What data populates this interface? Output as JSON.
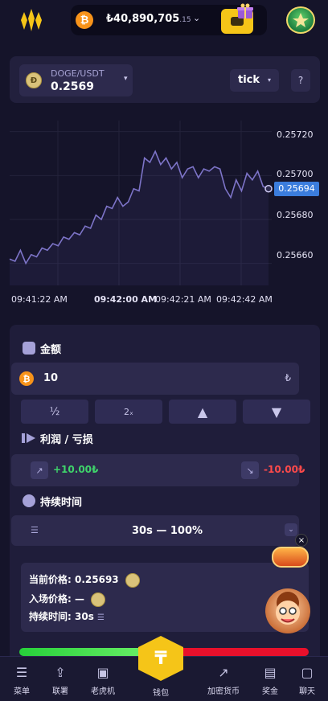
{
  "header": {
    "balance_currency_icon": "bitcoin-icon",
    "balance_main": "₺40,890,705",
    "balance_decimal": ".15",
    "balance_caret": "⌄"
  },
  "pair": {
    "name": "DOGE/USDT",
    "price": "0.2569",
    "caret": "▾"
  },
  "chart_toolbar": {
    "mode": "tick",
    "mode_caret": "▾",
    "help": "?"
  },
  "chart_data": {
    "type": "line",
    "x_ticks": [
      "09:41:22 AM",
      "09:42:00 AM",
      "09:42:21 AM",
      "09:42:42 AM"
    ],
    "y_ticks": [
      "0.25720",
      "0.25700",
      "0.25680",
      "0.25660"
    ],
    "ylim": [
      0.2565,
      0.25725
    ],
    "current_price_label": "0.25694",
    "current_value": 0.25694,
    "series": [
      {
        "values": [
          0.25662,
          0.25661,
          0.25666,
          0.2566,
          0.25664,
          0.25663,
          0.25667,
          0.25666,
          0.25669,
          0.25668,
          0.25672,
          0.25671,
          0.25674,
          0.25673,
          0.25677,
          0.25676,
          0.25682,
          0.2568,
          0.25686,
          0.25685,
          0.2569,
          0.25686,
          0.25688,
          0.25694,
          0.25693,
          0.25708,
          0.25706,
          0.25711,
          0.25705,
          0.25708,
          0.25703,
          0.25706,
          0.25699,
          0.25703,
          0.25704,
          0.25699,
          0.25703,
          0.25702,
          0.25704,
          0.25703,
          0.25694,
          0.2569,
          0.25698,
          0.25693,
          0.25701,
          0.25698,
          0.25702,
          0.25695,
          0.25694
        ]
      }
    ],
    "grid": true
  },
  "trade": {
    "amount_label": "金额",
    "amount_value": "10",
    "amount_unit": "₺",
    "half_label": "½",
    "double_label": "2ₓ",
    "up_label": "▲",
    "down_label": "▼",
    "pl_label": "利润 / 亏损",
    "profit": "+10.00₺",
    "loss": "-10.00₺",
    "duration_label": "持续时间",
    "duration_value": "30s — 100%",
    "info_current_label": "当前价格:",
    "info_current_value": "0.25693",
    "info_entry_label": "入场价格:",
    "info_entry_value": "—",
    "info_duration_label": "持续时间:",
    "info_duration_value": "30s",
    "up_share": 0.48
  },
  "promo": {
    "close": "×"
  },
  "nav": {
    "items": [
      {
        "label": "菜单",
        "icon": "menu-icon"
      },
      {
        "label": "联署",
        "icon": "share-icon"
      },
      {
        "label": "老虎机",
        "icon": "slot-machine-icon"
      },
      {
        "label": "钱包",
        "icon": "wallet-icon"
      },
      {
        "label": "加密货币",
        "icon": "chart-icon"
      },
      {
        "label": "奖金",
        "icon": "bonus-icon"
      },
      {
        "label": "聊天",
        "icon": "chat-icon"
      }
    ],
    "wallet_symbol": "₸"
  },
  "colors": {
    "line": "#7d74c8",
    "profit": "#3fd46b",
    "loss": "#ff4a4a",
    "accent_gold": "#f5c518",
    "price_tag": "#3b7ddd"
  }
}
